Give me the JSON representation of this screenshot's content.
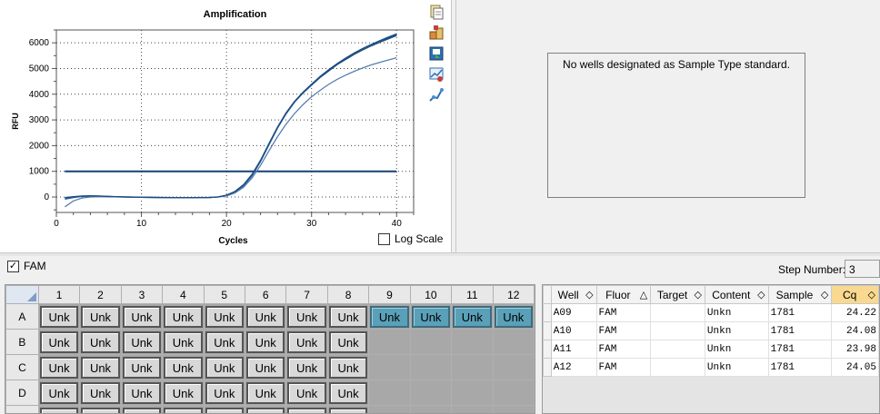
{
  "chart": {
    "toolbar_icons": [
      "copy-icon",
      "export-icon",
      "save-image-icon",
      "chart-settings-icon",
      "trace-style-icon"
    ],
    "log_scale_label": "Log Scale",
    "log_scale_checked": false
  },
  "chart_data": {
    "type": "line",
    "title": "Amplification",
    "xlabel": "Cycles",
    "ylabel": "RFU",
    "xlim": [
      0,
      42
    ],
    "ylim": [
      -600,
      6500
    ],
    "xticks": [
      0,
      10,
      20,
      30,
      40
    ],
    "yticks": [
      0,
      1000,
      2000,
      3000,
      4000,
      5000,
      6000
    ],
    "grid": true,
    "threshold": 1000,
    "series": [
      {
        "color": "#1f4e79",
        "x": [
          1,
          2,
          3,
          4,
          5,
          6,
          8,
          10,
          12,
          14,
          16,
          18,
          19,
          20,
          21,
          22,
          23,
          24,
          25,
          26,
          27,
          28,
          29,
          30,
          31,
          32,
          33,
          34,
          35,
          36,
          37,
          38,
          39,
          40
        ],
        "y": [
          -50,
          0,
          30,
          40,
          35,
          20,
          0,
          -10,
          -20,
          -25,
          -25,
          -20,
          0,
          60,
          200,
          450,
          850,
          1400,
          2050,
          2700,
          3250,
          3700,
          4050,
          4350,
          4650,
          4900,
          5150,
          5350,
          5550,
          5720,
          5880,
          6020,
          6150,
          6280
        ]
      },
      {
        "color": "#2b5f9e",
        "x": [
          1,
          2,
          3,
          4,
          5,
          6,
          8,
          10,
          12,
          14,
          16,
          18,
          19,
          20,
          21,
          22,
          23,
          24,
          25,
          26,
          27,
          28,
          29,
          30,
          31,
          32,
          33,
          34,
          35,
          36,
          37,
          38,
          39,
          40
        ],
        "y": [
          -80,
          -20,
          20,
          30,
          25,
          15,
          0,
          -10,
          -20,
          -25,
          -25,
          -20,
          0,
          50,
          190,
          430,
          820,
          1380,
          2030,
          2680,
          3230,
          3690,
          4060,
          4370,
          4680,
          4940,
          5180,
          5390,
          5590,
          5770,
          5930,
          6080,
          6220,
          6350
        ]
      },
      {
        "color": "#5a7fb0",
        "x": [
          1,
          2,
          3,
          4,
          5,
          6,
          8,
          10,
          12,
          14,
          16,
          18,
          19,
          20,
          21,
          22,
          23,
          24,
          25,
          26,
          27,
          28,
          29,
          30,
          31,
          32,
          33,
          34,
          35,
          36,
          37,
          38,
          39,
          40
        ],
        "y": [
          -380,
          -150,
          -40,
          0,
          10,
          10,
          0,
          -10,
          -20,
          -25,
          -25,
          -20,
          0,
          40,
          160,
          380,
          740,
          1230,
          1800,
          2350,
          2830,
          3250,
          3600,
          3900,
          4150,
          4380,
          4580,
          4740,
          4890,
          5020,
          5140,
          5240,
          5330,
          5420
        ]
      },
      {
        "color": "#1a4a80",
        "x": [
          1,
          2,
          3,
          4,
          5,
          6,
          8,
          10,
          12,
          14,
          16,
          18,
          19,
          20,
          21,
          22,
          23,
          24,
          25,
          26,
          27,
          28,
          29,
          30,
          31,
          32,
          33,
          34,
          35,
          36,
          37,
          38,
          39,
          40
        ],
        "y": [
          -20,
          10,
          40,
          50,
          40,
          25,
          5,
          -5,
          -15,
          -20,
          -20,
          -15,
          5,
          70,
          220,
          480,
          880,
          1430,
          2080,
          2720,
          3270,
          3720,
          4080,
          4390,
          4690,
          4950,
          5190,
          5400,
          5600,
          5780,
          5930,
          6070,
          6190,
          6310
        ]
      }
    ]
  },
  "right_panel": {
    "message": "No wells designated as Sample Type standard."
  },
  "fluor_filter": {
    "label": "FAM",
    "checked": true
  },
  "step": {
    "label": "Step Number:",
    "value": "3"
  },
  "plate": {
    "columns": [
      "1",
      "2",
      "3",
      "4",
      "5",
      "6",
      "7",
      "8",
      "9",
      "10",
      "11",
      "12"
    ],
    "rows": [
      {
        "label": "A",
        "wells": [
          "Unk",
          "Unk",
          "Unk",
          "Unk",
          "Unk",
          "Unk",
          "Unk",
          "Unk",
          "Unk",
          "Unk",
          "Unk",
          "Unk"
        ],
        "selected": [
          false,
          false,
          false,
          false,
          false,
          false,
          false,
          false,
          true,
          true,
          true,
          true
        ]
      },
      {
        "label": "B",
        "wells": [
          "Unk",
          "Unk",
          "Unk",
          "Unk",
          "Unk",
          "Unk",
          "Unk",
          "Unk",
          "",
          "",
          "",
          ""
        ],
        "selected": [
          false,
          false,
          false,
          false,
          false,
          false,
          false,
          false,
          false,
          false,
          false,
          false
        ]
      },
      {
        "label": "C",
        "wells": [
          "Unk",
          "Unk",
          "Unk",
          "Unk",
          "Unk",
          "Unk",
          "Unk",
          "Unk",
          "",
          "",
          "",
          ""
        ],
        "selected": [
          false,
          false,
          false,
          false,
          false,
          false,
          false,
          false,
          false,
          false,
          false,
          false
        ]
      },
      {
        "label": "D",
        "wells": [
          "Unk",
          "Unk",
          "Unk",
          "Unk",
          "Unk",
          "Unk",
          "Unk",
          "Unk",
          "",
          "",
          "",
          ""
        ],
        "selected": [
          false,
          false,
          false,
          false,
          false,
          false,
          false,
          false,
          false,
          false,
          false,
          false
        ]
      },
      {
        "label": "E",
        "wells": [
          "Unk",
          "Unk",
          "Unk",
          "Unk",
          "Unk",
          "Unk",
          "Unk",
          "Unk",
          "",
          "",
          "",
          ""
        ],
        "selected": [
          false,
          false,
          false,
          false,
          false,
          false,
          false,
          false,
          false,
          false,
          false,
          false
        ]
      }
    ]
  },
  "results": {
    "headers": [
      {
        "label": "Well",
        "sort": "◇"
      },
      {
        "label": "Fluor",
        "sort": "△"
      },
      {
        "label": "Target",
        "sort": "◇"
      },
      {
        "label": "Content",
        "sort": "◇"
      },
      {
        "label": "Sample",
        "sort": "◇"
      },
      {
        "label": "Cq",
        "sort": "◇"
      }
    ],
    "rows": [
      [
        "A09",
        "FAM",
        "",
        "Unkn",
        "1781",
        "24.22"
      ],
      [
        "A10",
        "FAM",
        "",
        "Unkn",
        "1781",
        "24.08"
      ],
      [
        "A11",
        "FAM",
        "",
        "Unkn",
        "1781",
        "23.98"
      ],
      [
        "A12",
        "FAM",
        "",
        "Unkn",
        "1781",
        "24.05"
      ]
    ]
  }
}
